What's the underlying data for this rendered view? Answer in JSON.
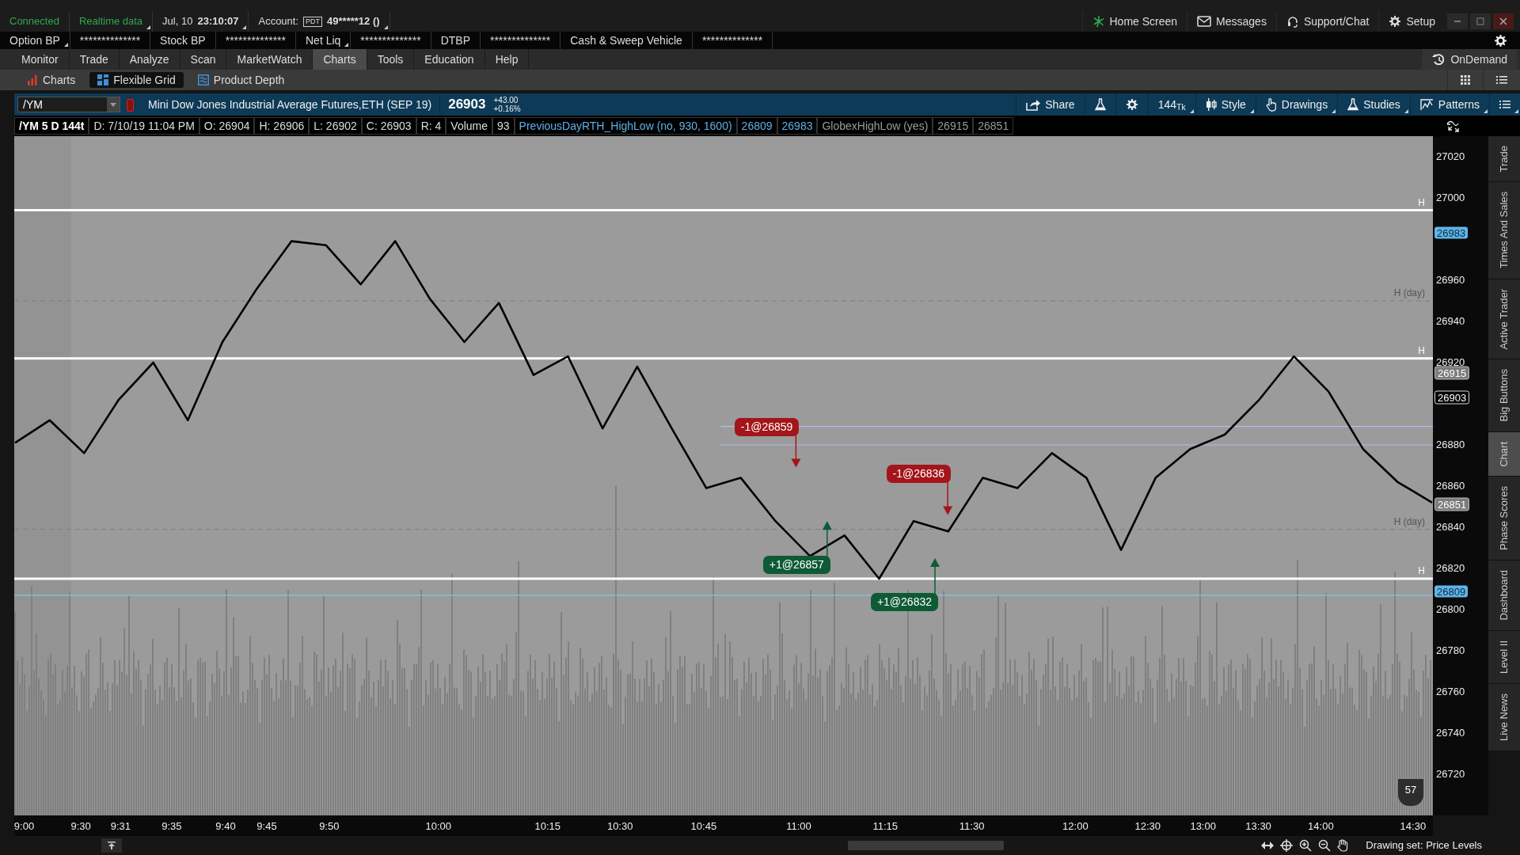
{
  "status_bar": {
    "connection": "Connected",
    "data_feed": "Realtime data",
    "date": "Jul, 10",
    "time": "23:10:07",
    "account_label": "Account:",
    "account_badge": "PDT",
    "account": "49*****12 ()",
    "links": [
      {
        "kind": "home",
        "label": "Home Screen"
      },
      {
        "kind": "envelope",
        "label": "Messages"
      },
      {
        "kind": "headset",
        "label": "Support/Chat"
      },
      {
        "kind": "gear",
        "label": "Setup"
      }
    ]
  },
  "balances": [
    {
      "label": "Option BP",
      "value": "**************",
      "dropdown": true
    },
    {
      "label": "Stock BP",
      "value": "**************",
      "dropdown": false
    },
    {
      "label": "Net Liq",
      "value": "**************",
      "dropdown": true
    },
    {
      "label": "DTBP",
      "value": "**************",
      "dropdown": false
    },
    {
      "label": "Cash & Sweep Vehicle",
      "value": "**************",
      "dropdown": false
    }
  ],
  "menu": {
    "items": [
      {
        "label": "Monitor",
        "selected": false
      },
      {
        "label": "Trade",
        "selected": false
      },
      {
        "label": "Analyze",
        "selected": false
      },
      {
        "label": "Scan",
        "selected": false
      },
      {
        "label": "MarketWatch",
        "selected": false
      },
      {
        "label": "Charts",
        "selected": true
      },
      {
        "label": "Tools",
        "selected": false
      },
      {
        "label": "Education",
        "selected": false
      },
      {
        "label": "Help",
        "selected": false
      }
    ],
    "on_demand": "OnDemand"
  },
  "subtabs": [
    {
      "kind": "bars",
      "label": "Charts",
      "selected": false
    },
    {
      "kind": "grid",
      "label": "Flexible Grid",
      "selected": true
    },
    {
      "kind": "depth",
      "label": "Product Depth",
      "selected": false
    }
  ],
  "chart_header": {
    "symbol": "/YM",
    "description": "Mini Dow Jones Industrial Average Futures,ETH (SEP 19)",
    "last": "26903",
    "change": "+43.00",
    "change_pct": "+0.16%",
    "tools": [
      {
        "kind": "share",
        "label": "Share",
        "dropdown": false
      },
      {
        "kind": "flask",
        "dropdown": false
      },
      {
        "kind": "gear",
        "dropdown": false
      },
      {
        "kind": "aggregation",
        "label": "144$_{Tk}$",
        "dropdown": true
      },
      {
        "kind": "style",
        "label": "Style",
        "dropdown": true
      },
      {
        "kind": "drawings",
        "label": "Drawings",
        "dropdown": true
      },
      {
        "kind": "studies",
        "label": "Studies",
        "dropdown": true
      },
      {
        "kind": "patterns",
        "label": "Patterns",
        "dropdown": true
      },
      {
        "kind": "menu",
        "dropdown": true
      }
    ]
  },
  "info_line": [
    {
      "kind": "title",
      "text": "/YM 5 D 144t"
    },
    {
      "kind": "plain",
      "text": "D: 7/10/19 11:04 PM"
    },
    {
      "kind": "plain",
      "text": "O: 26904"
    },
    {
      "kind": "plain",
      "text": "H: 26906"
    },
    {
      "kind": "plain",
      "text": "L: 26902"
    },
    {
      "kind": "plain",
      "text": "C: 26903"
    },
    {
      "kind": "plain",
      "text": "R: 4"
    },
    {
      "kind": "plain",
      "text": "Volume"
    },
    {
      "kind": "plain",
      "text": "93"
    },
    {
      "kind": "study",
      "text": "PreviousDayRTH_HighLow (no, 930, 1600)"
    },
    {
      "kind": "study",
      "text": "26809"
    },
    {
      "kind": "study",
      "text": "26983"
    },
    {
      "kind": "muted",
      "text": "GlobexHighLow (yes)"
    },
    {
      "kind": "muted",
      "text": "26915"
    },
    {
      "kind": "muted",
      "text": "26851"
    }
  ],
  "chart": {
    "chart_data": {
      "type": "line",
      "categories": [
        null,
        null,
        null,
        null,
        null,
        null,
        null,
        null,
        null,
        null,
        null,
        null,
        null,
        null,
        null,
        null,
        null,
        null,
        null,
        null,
        null,
        null,
        null,
        null,
        null,
        null,
        null,
        null,
        null,
        null,
        null,
        null,
        null,
        null,
        null,
        null,
        null,
        null,
        null,
        null,
        null,
        null
      ],
      "values": [
        26881,
        26892,
        26876,
        26902,
        26920,
        26892,
        26930,
        26956,
        26979,
        26977,
        26958,
        26979,
        26951,
        26930,
        26949,
        26914,
        26923,
        26888,
        26918,
        26888,
        26859,
        26864,
        26843,
        26826,
        26836,
        26815,
        26843,
        26838,
        26864,
        26859,
        26876,
        26864,
        26829,
        26864,
        26878,
        26885,
        26902,
        26923,
        26906,
        26878,
        26862,
        26852
      ],
      "ylim": [
        26700,
        27030
      ],
      "yticks": [
        26720,
        26740,
        26760,
        26780,
        26800,
        26820,
        26840,
        26860,
        26880,
        26920,
        26940,
        26960,
        27000,
        27020
      ],
      "ref_lines": [
        {
          "axis": "y",
          "value": 26889,
          "color": "#b8b8f0"
        },
        {
          "axis": "y",
          "value": 26880,
          "color": "#b8b8f0"
        },
        {
          "axis": "y",
          "value": 26807,
          "color": "#7fc6ec"
        }
      ]
    },
    "levels": [
      {
        "kind": "level",
        "label": "H"
      },
      {
        "kind": "day",
        "label": "H (day)"
      },
      {
        "kind": "level",
        "label": "H"
      },
      {
        "kind": "day",
        "label": "H (day)"
      },
      {
        "kind": "level",
        "label": "H"
      }
    ],
    "orders": [
      {
        "kind": "sell",
        "label": "-1@26859"
      },
      {
        "kind": "buy",
        "label": "+1@26857"
      },
      {
        "kind": "sell",
        "label": "-1@26836"
      },
      {
        "kind": "buy",
        "label": "+1@26832"
      }
    ],
    "price_labels": [
      {
        "kind": "study",
        "text": "26983"
      },
      {
        "kind": "muted",
        "text": "26915"
      },
      {
        "kind": "last",
        "text": "26903"
      },
      {
        "kind": "muted",
        "text": "26851"
      },
      {
        "kind": "study",
        "text": "26809"
      }
    ],
    "time_labels": [
      "9:00",
      "9:30",
      "9:31",
      "9:35",
      "9:40",
      "9:45",
      "9:50",
      "10:00",
      "10:15",
      "10:30",
      "10:45",
      "11:00",
      "11:15",
      "11:30",
      "12:00",
      "12:30",
      "13:00",
      "13:30",
      "14:00",
      "14:30"
    ],
    "badge": "57"
  },
  "side_tabs": [
    {
      "label": "Trade",
      "selected": false
    },
    {
      "label": "Times And Sales",
      "selected": false
    },
    {
      "label": "Active Trader",
      "selected": false
    },
    {
      "label": "Big Buttons",
      "selected": false
    },
    {
      "label": "Chart",
      "selected": true
    },
    {
      "label": "Phase Scores",
      "selected": false
    },
    {
      "label": "Dashboard",
      "selected": false
    },
    {
      "label": "Level II",
      "selected": false
    },
    {
      "label": "Live News",
      "selected": false
    }
  ],
  "drawing_set": "Drawing set: Price Levels"
}
